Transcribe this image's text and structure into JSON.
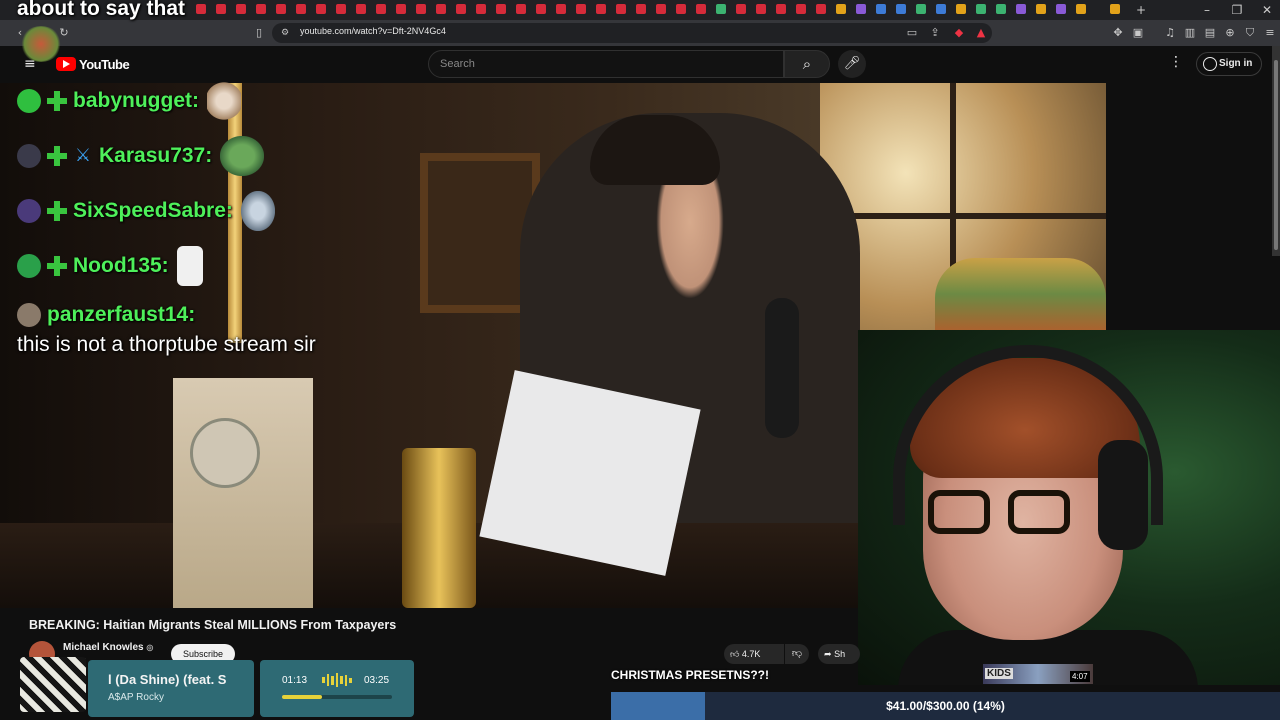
{
  "overlay": {
    "caption": "about to say that"
  },
  "browser": {
    "url": "youtube.com/watch?v=Dft-2NV4Gc4",
    "window_controls": [
      "–",
      "❐",
      "✕"
    ],
    "new_tab": "+"
  },
  "youtube": {
    "logo_text": "YouTube",
    "search_placeholder": "Search",
    "sign_in": "Sign in"
  },
  "chat": {
    "lines": [
      {
        "username": "babynugget:"
      },
      {
        "username": "Karasu737:"
      },
      {
        "username": "SixSpeedSabre:"
      },
      {
        "username": "Nood135:"
      },
      {
        "username": "panzerfaust14:"
      }
    ],
    "message": "this is not a thorptube stream sir"
  },
  "video_info": {
    "title": "BREAKING: Haitian Migrants Steal MILLIONS From Taxpayers",
    "channel": "Michael Knowles",
    "verified_mark": "◎",
    "subscribe": "Subscribe",
    "likes": "4.7K",
    "share": "Sh"
  },
  "music": {
    "track": "l (Da Shine) (feat. S",
    "artist": "A$AP Rocky",
    "elapsed": "01:13",
    "total": "03:25",
    "progress": 0.36
  },
  "goal": {
    "label": "CHRISTMAS PRESETNS??!",
    "text": "$41.00/$300.00 (14%)",
    "fraction": 0.14
  },
  "mini_thumb": {
    "label": "KIDS",
    "duration": "4:07"
  },
  "colors": {
    "chat_username": "#4ef05a",
    "goal_fill": "#3b6ea8",
    "music_card": "#2e6a74",
    "music_accent": "#e6d23a"
  }
}
